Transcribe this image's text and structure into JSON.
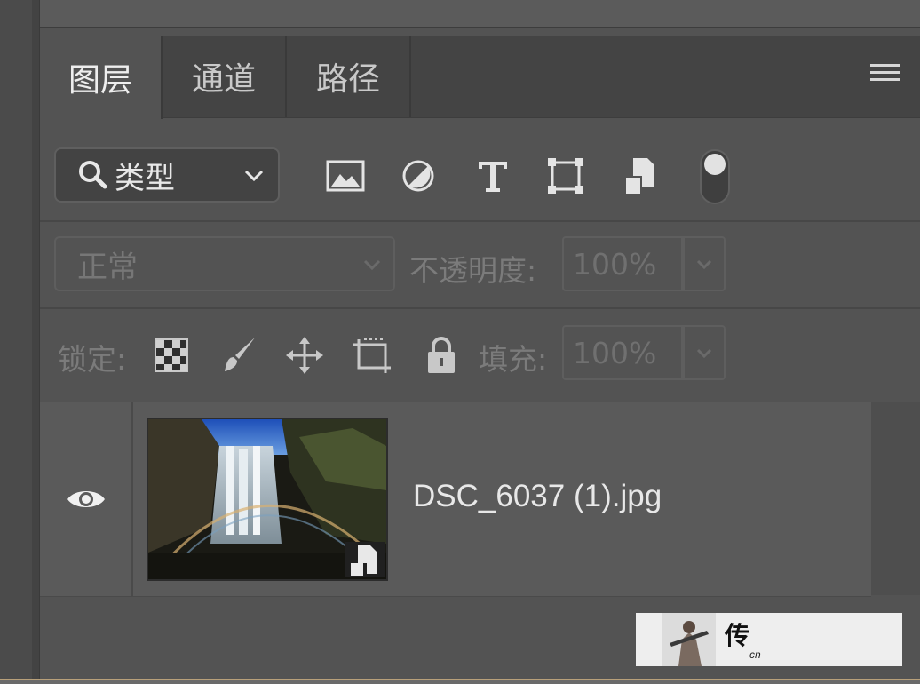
{
  "tabs": [
    {
      "label": "图层",
      "active": true
    },
    {
      "label": "通道",
      "active": false
    },
    {
      "label": "路径",
      "active": false
    }
  ],
  "filter": {
    "label": "类型",
    "icons": [
      "image-filter-icon",
      "adjustment-filter-icon",
      "type-filter-icon",
      "shape-filter-icon",
      "smart-object-filter-icon"
    ]
  },
  "blend": {
    "mode": "正常",
    "opacity_label": "不透明度:",
    "opacity_value": "100%"
  },
  "lock": {
    "label": "锁定:",
    "icons": [
      "lock-transparent-pixels-icon",
      "lock-image-pixels-icon",
      "lock-position-icon",
      "lock-artboard-icon",
      "lock-all-icon"
    ],
    "fill_label": "填充:",
    "fill_value": "100%"
  },
  "layers": [
    {
      "name": "DSC_6037 (1).jpg",
      "visible": true,
      "smart_object": true
    }
  ],
  "watermark": {
    "text": "传",
    "sub": "cn"
  },
  "colors": {
    "panel_bg": "#535353",
    "tabbar_bg": "#444444",
    "text": "#e8e8e8",
    "disabled_text": "#777777"
  }
}
